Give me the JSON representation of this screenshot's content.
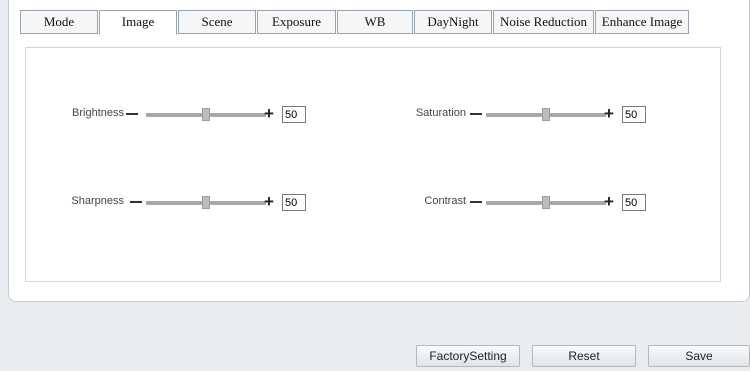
{
  "tabs": [
    {
      "label": "Mode",
      "active": false
    },
    {
      "label": "Image",
      "active": true
    },
    {
      "label": "Scene",
      "active": false
    },
    {
      "label": "Exposure",
      "active": false
    },
    {
      "label": "WB",
      "active": false
    },
    {
      "label": "DayNight",
      "active": false
    },
    {
      "label": "Noise Reduction",
      "active": false
    },
    {
      "label": "Enhance Image",
      "active": false
    }
  ],
  "controls": {
    "brightness": {
      "label": "Brightness",
      "value": "50",
      "level": 0.5
    },
    "saturation": {
      "label": "Saturation",
      "value": "50",
      "level": 0.5
    },
    "sharpness": {
      "label": "Sharpness",
      "value": "50",
      "level": 0.5
    },
    "contrast": {
      "label": "Contrast",
      "value": "50",
      "level": 0.5
    }
  },
  "buttons": {
    "factory": "FactorySetting",
    "reset": "Reset",
    "save": "Save"
  },
  "icons": {
    "minus": "minus-icon",
    "plus": "plus-icon"
  },
  "symbols": {
    "plus": "+"
  }
}
